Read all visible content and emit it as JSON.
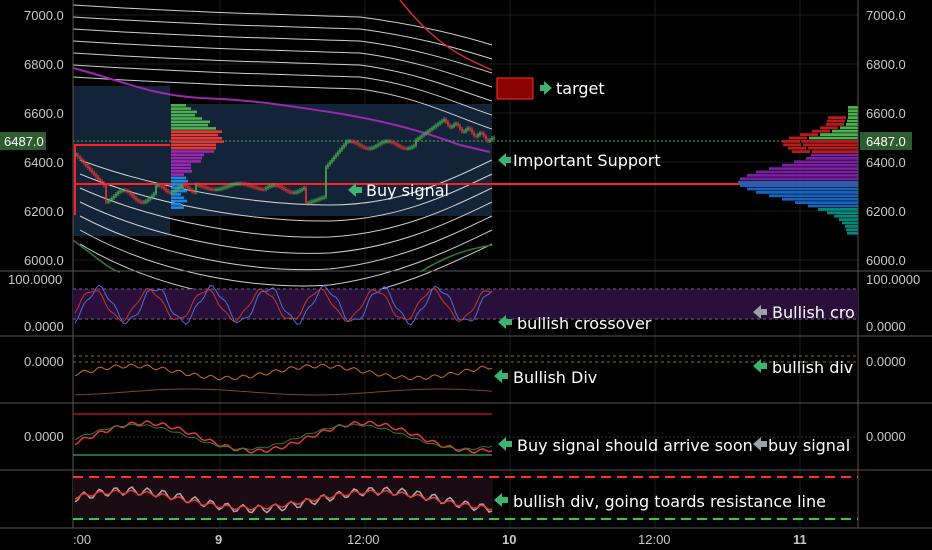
{
  "chart_data": [
    {
      "type": "candlestick",
      "panel": "price",
      "y_ticks": [
        "7000.0",
        "6800.0",
        "6600.0",
        "6400.0",
        "6200.0",
        "6000.0"
      ],
      "ylim": [
        5970,
        7060
      ],
      "last_price_label": "6487.0",
      "last_price": 6487,
      "support_level": 6310,
      "annotations": [
        "target",
        "Important Support",
        "Buy signal"
      ]
    },
    {
      "type": "line",
      "panel": "stochastic",
      "y_ticks": [
        "100.0000",
        "0.0000"
      ],
      "annotations": [
        "bullish crossover",
        "Bullish cro"
      ]
    },
    {
      "type": "line",
      "panel": "oscillator",
      "y_ticks": [
        "0.0000"
      ],
      "annotations": [
        "Bullish Div",
        "bullish div"
      ]
    },
    {
      "type": "line",
      "panel": "momentum",
      "y_ticks": [
        "0.0000"
      ],
      "annotations": [
        "Buy signal should arrive soon",
        "buy signal"
      ]
    },
    {
      "type": "line",
      "panel": "rsi",
      "annotations": [
        "bullish div, going toards resistance line"
      ]
    }
  ],
  "x_ticks": [
    ":00",
    "9",
    "12:00",
    "10",
    "12:00",
    "11"
  ],
  "colors": {
    "background": "#000000",
    "bull": "#4caf50",
    "bear": "#e53935",
    "support": "#ff2020",
    "volume_profile_blue": "#1e3a5a",
    "purple_band": "#7b1fa2",
    "price_tag": "#2f5c2f"
  }
}
